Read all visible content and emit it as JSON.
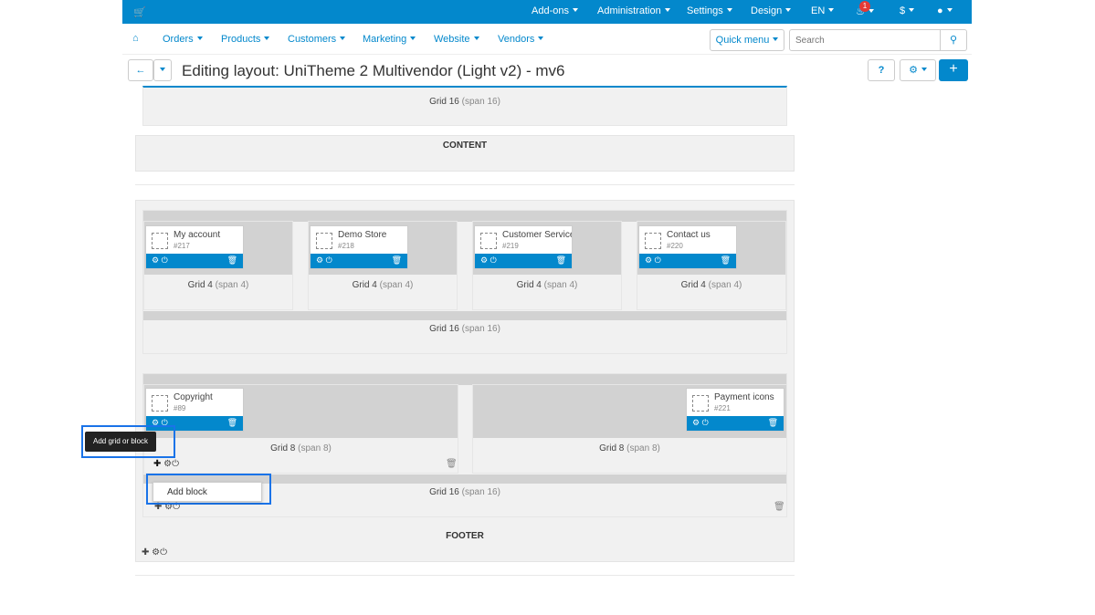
{
  "topbar": {
    "menus": [
      "Add-ons",
      "Administration",
      "Settings",
      "Design",
      "EN",
      "$"
    ],
    "notification_count": "1",
    "brand_color": "#0388cc"
  },
  "navbar": {
    "items": [
      "Orders",
      "Products",
      "Customers",
      "Marketing",
      "Website",
      "Vendors"
    ],
    "quick_menu": "Quick menu",
    "search_placeholder": "Search"
  },
  "titlebar": {
    "title": "Editing layout: UniTheme 2 Multivendor (Light v2) - mv6"
  },
  "layout": {
    "top_grid": {
      "label": "Grid 16",
      "span": "(span 16)"
    },
    "content_label": "CONTENT",
    "footer_section": {
      "grid4": [
        {
          "name": "My account",
          "id": "#217",
          "label": "Grid 4",
          "span": "(span 4)"
        },
        {
          "name": "Demo Store",
          "id": "#218",
          "label": "Grid 4",
          "span": "(span 4)"
        },
        {
          "name": "Customer Service",
          "id": "#219",
          "label": "Grid 4",
          "span": "(span 4)"
        },
        {
          "name": "Contact us",
          "id": "#220",
          "label": "Grid 4",
          "span": "(span 4)"
        }
      ],
      "grid16_a": {
        "label": "Grid 16",
        "span": "(span 16)"
      },
      "grid8": [
        {
          "name": "Copyright",
          "id": "#89",
          "label": "Grid 8",
          "span": "(span 8)"
        },
        {
          "name": "Payment icons",
          "id": "#221",
          "label": "Grid 8",
          "span": "(span 8)"
        }
      ],
      "grid16_b": {
        "label": "Grid 16",
        "span": "(span 16)"
      }
    },
    "footer_label": "FOOTER"
  },
  "tooltip": "Add grid or block",
  "dropdown_item": "Add block"
}
